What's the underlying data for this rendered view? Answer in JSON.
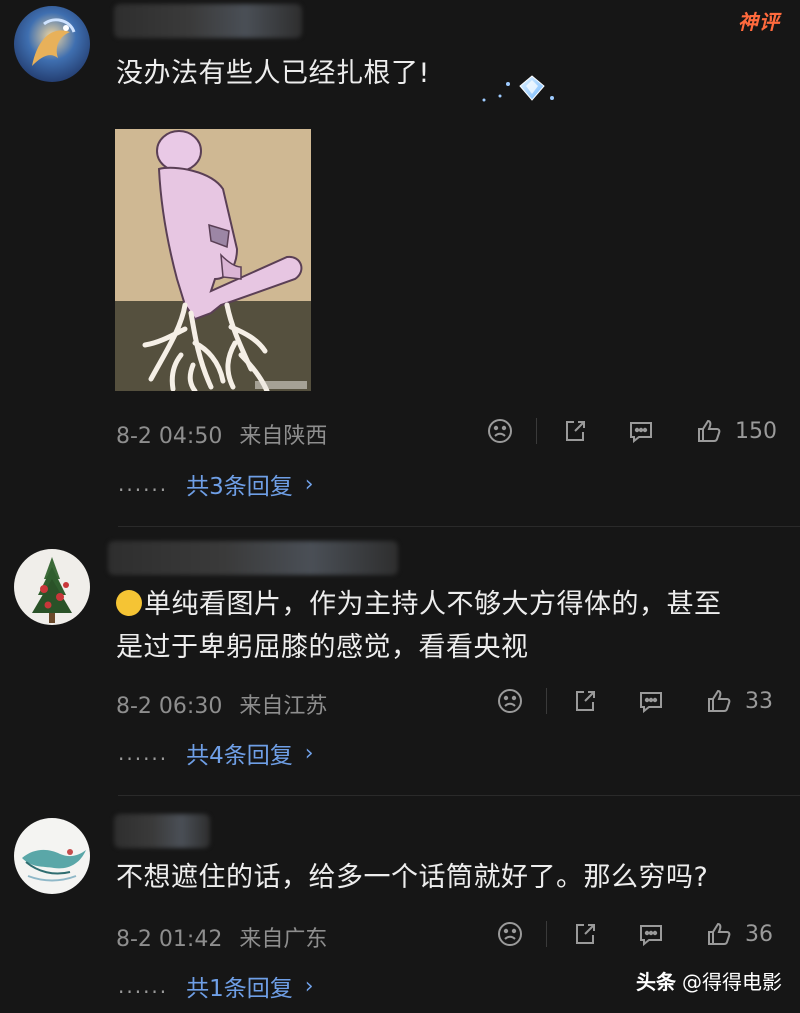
{
  "badge": {
    "label": "神评"
  },
  "comments": [
    {
      "text": "没办法有些人已经扎根了!",
      "time": "8-2 04:50",
      "location": "来自陕西",
      "likes": "150",
      "replies_label": "共3条回复",
      "dots": "......"
    },
    {
      "text_line1": "单纯看图片，作为主持人不够大方得体的，甚至",
      "text_line2": "是过于卑躬屈膝的感觉，看看央视",
      "time": "8-2 06:30",
      "location": "来自江苏",
      "likes": "33",
      "replies_label": "共4条回复",
      "dots": "......"
    },
    {
      "text": "不想遮住的话，给多一个话筒就好了。那么穷吗?",
      "time": "8-2 01:42",
      "location": "来自广东",
      "likes": "36",
      "replies_label": "共1条回复",
      "dots": "......"
    }
  ],
  "meme": {
    "watermark": "头条 @..."
  },
  "watermark": {
    "platform": "头条",
    "account": "@得得电影"
  },
  "icons": {
    "dislike": "frown-face-icon",
    "share": "share-icon",
    "comment": "comment-icon",
    "like": "thumbs-up-icon",
    "chevron": "chevron-right-icon"
  },
  "colors": {
    "background": "#161616",
    "link": "#6f9fe6",
    "hot_badge": "#ff6a3d"
  }
}
